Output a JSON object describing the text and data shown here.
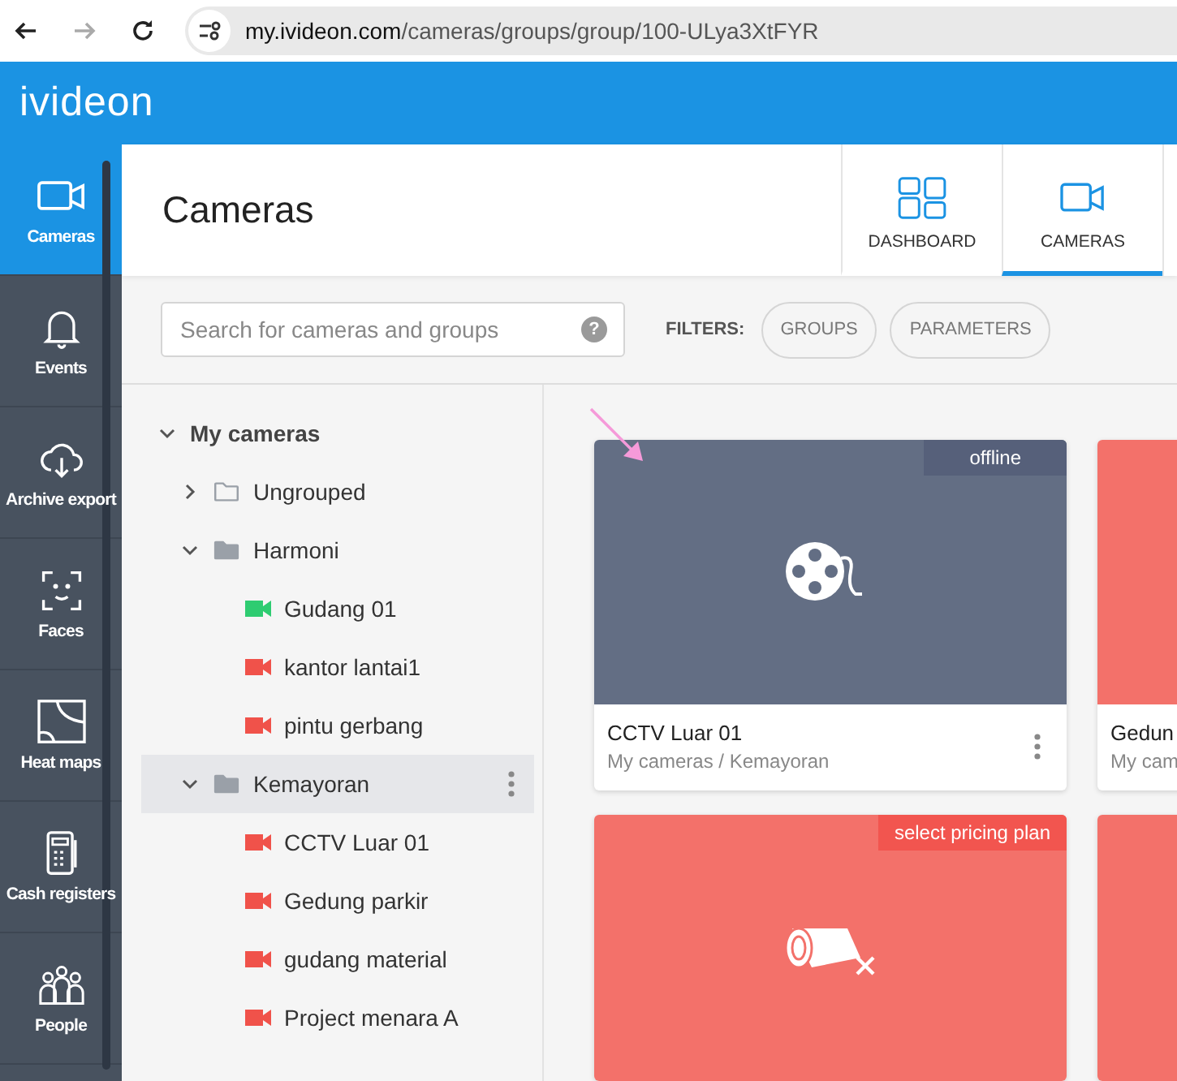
{
  "browser": {
    "back_disabled": false,
    "forward_disabled": true,
    "url_domain": "my.ivideon.com",
    "url_path": "/cameras/groups/group/100-ULya3XtFYR"
  },
  "app": {
    "logo": "ivideon"
  },
  "sidebar": {
    "items": [
      {
        "label": "Cameras",
        "selected": true
      },
      {
        "label": "Events",
        "selected": false
      },
      {
        "label": "Archive export",
        "selected": false
      },
      {
        "label": "Faces",
        "selected": false
      },
      {
        "label": "Heat maps",
        "selected": false
      },
      {
        "label": "Cash registers",
        "selected": false
      },
      {
        "label": "People",
        "selected": false
      }
    ]
  },
  "header": {
    "title": "Cameras",
    "tabs": [
      {
        "label": "DASHBOARD",
        "selected": false
      },
      {
        "label": "CAMERAS",
        "selected": true
      }
    ]
  },
  "filters": {
    "search": {
      "placeholder": "Search for cameras and groups",
      "help": "?"
    },
    "label": "FILTERS:",
    "chips": [
      "GROUPS",
      "PARAMETERS"
    ]
  },
  "tree": [
    {
      "kind": "root",
      "label": "My cameras",
      "expanded": true,
      "selected": false,
      "children": [
        {
          "kind": "folder",
          "label": "Ungrouped",
          "expanded": false,
          "selected": false
        },
        {
          "kind": "folder",
          "label": "Harmoni",
          "expanded": true,
          "selected": false,
          "children": [
            {
              "kind": "camera",
              "label": "Gudang 01",
              "color": "#2ecc71",
              "selected": false
            },
            {
              "kind": "camera",
              "label": "kantor lantai1",
              "color": "#f0524a",
              "selected": false
            },
            {
              "kind": "camera",
              "label": "pintu gerbang",
              "color": "#f0524a",
              "selected": false
            }
          ]
        },
        {
          "kind": "folder",
          "label": "Kemayoran",
          "expanded": true,
          "selected": true,
          "children": [
            {
              "kind": "camera",
              "label": "CCTV Luar 01",
              "color": "#f0524a",
              "selected": false
            },
            {
              "kind": "camera",
              "label": "Gedung parkir",
              "color": "#f0524a",
              "selected": false
            },
            {
              "kind": "camera",
              "label": "gudang material",
              "color": "#f0524a",
              "selected": false
            },
            {
              "kind": "camera",
              "label": "Project menara A",
              "color": "#f0524a",
              "selected": false
            }
          ]
        }
      ]
    }
  ],
  "cards": [
    {
      "kind": "offline",
      "badge": "offline",
      "title": "CCTV Luar 01",
      "subtitle": "My cameras / Kemayoran"
    },
    {
      "kind": "unpaid",
      "title": "Gedun",
      "subtitle": "My cam"
    },
    {
      "kind": "unpaid",
      "badge": "select pricing plan"
    },
    {
      "kind": "unpaid"
    }
  ]
}
